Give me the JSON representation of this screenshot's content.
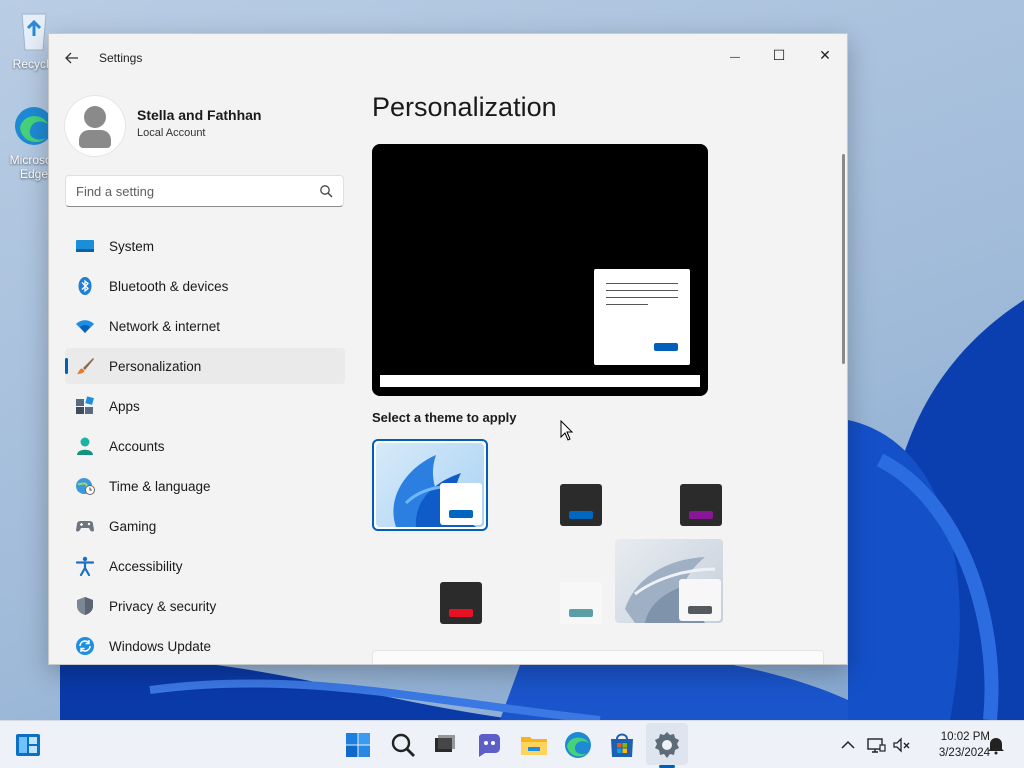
{
  "desktop": {
    "icons": [
      {
        "label": "Recycle",
        "icon": "recycle-bin-icon"
      },
      {
        "label": "Microsoft Edge",
        "icon": "edge-icon"
      }
    ]
  },
  "window": {
    "title": "Settings",
    "controls": {
      "minimize": "—",
      "maximize": "☐",
      "close": "✕"
    }
  },
  "sidebar": {
    "profile": {
      "name": "Stella and Fathhan",
      "account_type": "Local Account"
    },
    "search": {
      "placeholder": "Find a setting"
    },
    "items": [
      {
        "label": "System",
        "icon": "system-icon",
        "active": false
      },
      {
        "label": "Bluetooth & devices",
        "icon": "bluetooth-icon",
        "active": false
      },
      {
        "label": "Network & internet",
        "icon": "wifi-icon",
        "active": false
      },
      {
        "label": "Personalization",
        "icon": "brush-icon",
        "active": true
      },
      {
        "label": "Apps",
        "icon": "apps-icon",
        "active": false
      },
      {
        "label": "Accounts",
        "icon": "accounts-icon",
        "active": false
      },
      {
        "label": "Time & language",
        "icon": "globe-clock-icon",
        "active": false
      },
      {
        "label": "Gaming",
        "icon": "gamepad-icon",
        "active": false
      },
      {
        "label": "Accessibility",
        "icon": "accessibility-icon",
        "active": false
      },
      {
        "label": "Privacy & security",
        "icon": "shield-icon",
        "active": false
      },
      {
        "label": "Windows Update",
        "icon": "update-icon",
        "active": false
      }
    ]
  },
  "main": {
    "title": "Personalization",
    "section_label": "Select a theme to apply",
    "themes": [
      {
        "name": "windows-light",
        "selected": true,
        "accent": "#0067c0"
      },
      {
        "name": "windows-dark",
        "selected": false,
        "accent": "#0067c0"
      },
      {
        "name": "dark-purple",
        "selected": false,
        "accent": "#881798"
      },
      {
        "name": "dark-red",
        "selected": false,
        "accent": "#e81123"
      },
      {
        "name": "light-teal",
        "selected": false,
        "accent": "#5c9ea8"
      },
      {
        "name": "glow",
        "selected": false,
        "accent": "#555a61"
      }
    ]
  },
  "taskbar": {
    "apps": [
      "widgets-icon",
      "start-icon",
      "search-icon",
      "task-view-icon",
      "chat-icon",
      "file-explorer-icon",
      "edge-icon",
      "store-icon",
      "settings-icon"
    ],
    "clock": {
      "time": "10:02 PM",
      "date": "3/23/2024"
    }
  },
  "colors": {
    "accent": "#005fb8",
    "window_bg": "#f3f3f3"
  }
}
